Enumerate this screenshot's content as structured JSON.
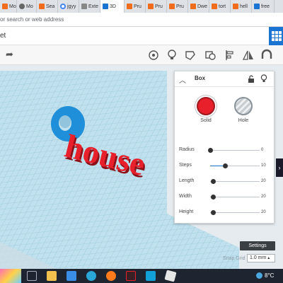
{
  "browser": {
    "tabs": [
      {
        "label": "Mo",
        "icon": "tinkercad-icon",
        "color": "#f26c1e"
      },
      {
        "label": "Mo",
        "icon": "gear-icon",
        "color": "#666666"
      },
      {
        "label": "Sea",
        "icon": "tinkercad-icon",
        "color": "#f26c1e"
      },
      {
        "label": "jgyy",
        "icon": "google-icon",
        "color": "#4285f4"
      },
      {
        "label": "Exte",
        "icon": "puzzle-icon",
        "color": "#666666"
      },
      {
        "label": "3D",
        "icon": "tinkercad-icon",
        "color": "#1a74d2",
        "active": true
      },
      {
        "label": "Pru",
        "icon": "tinkercad-icon",
        "color": "#f26c1e"
      },
      {
        "label": "Pru",
        "icon": "tinkercad-icon",
        "color": "#f26c1e"
      },
      {
        "label": "Pru",
        "icon": "tinkercad-icon",
        "color": "#f26c1e"
      },
      {
        "label": "Dwe",
        "icon": "tinkercad-icon",
        "color": "#f26c1e"
      },
      {
        "label": "tort",
        "icon": "tinkercad-icon",
        "color": "#f26c1e"
      },
      {
        "label": "hell",
        "icon": "tinkercad-icon",
        "color": "#f26c1e"
      },
      {
        "label": "free",
        "icon": "site-icon",
        "color": "#1a74d2"
      }
    ],
    "address_placeholder": "or search or web address"
  },
  "app": {
    "title": "et",
    "grid_button_icon": "grid-icon"
  },
  "toolbar": {
    "redo_icon": "redo-icon",
    "icons": [
      "comment-icon",
      "bulb-icon",
      "note-icon",
      "hole-icon",
      "align-icon",
      "mirror-icon",
      "magnet-icon"
    ]
  },
  "model": {
    "text": "house",
    "text_color": "#e8202b",
    "ring_color": "#1e8fd8"
  },
  "inspector": {
    "title": "Box",
    "collapse_icon": "chevron-up-icon",
    "lock_icon": "lock-icon",
    "bulb_icon": "bulb-icon",
    "solid_label": "Solid",
    "hole_label": "Hole",
    "solid_color": "#e8202b",
    "properties": [
      {
        "label": "Radius",
        "value": "0",
        "fraction": 0
      },
      {
        "label": "Steps",
        "value": "10",
        "fraction": 0.3
      },
      {
        "label": "Length",
        "value": "20",
        "fraction": 0.06
      },
      {
        "label": "Width",
        "value": "20",
        "fraction": 0.06
      },
      {
        "label": "Height",
        "value": "20",
        "fraction": 0.06
      }
    ]
  },
  "side_panel_arrow": "›",
  "settings_label": "Settings",
  "snap_grid_label": "Snap Grid",
  "snap_grid_value": "1.0 mm",
  "taskbar": {
    "apps": [
      "start-icon",
      "file-explorer-icon",
      "store-icon",
      "edge-icon",
      "firefox-icon",
      "app-icon",
      "cortana-icon",
      "roblox-icon"
    ],
    "temperature": "8°C"
  }
}
